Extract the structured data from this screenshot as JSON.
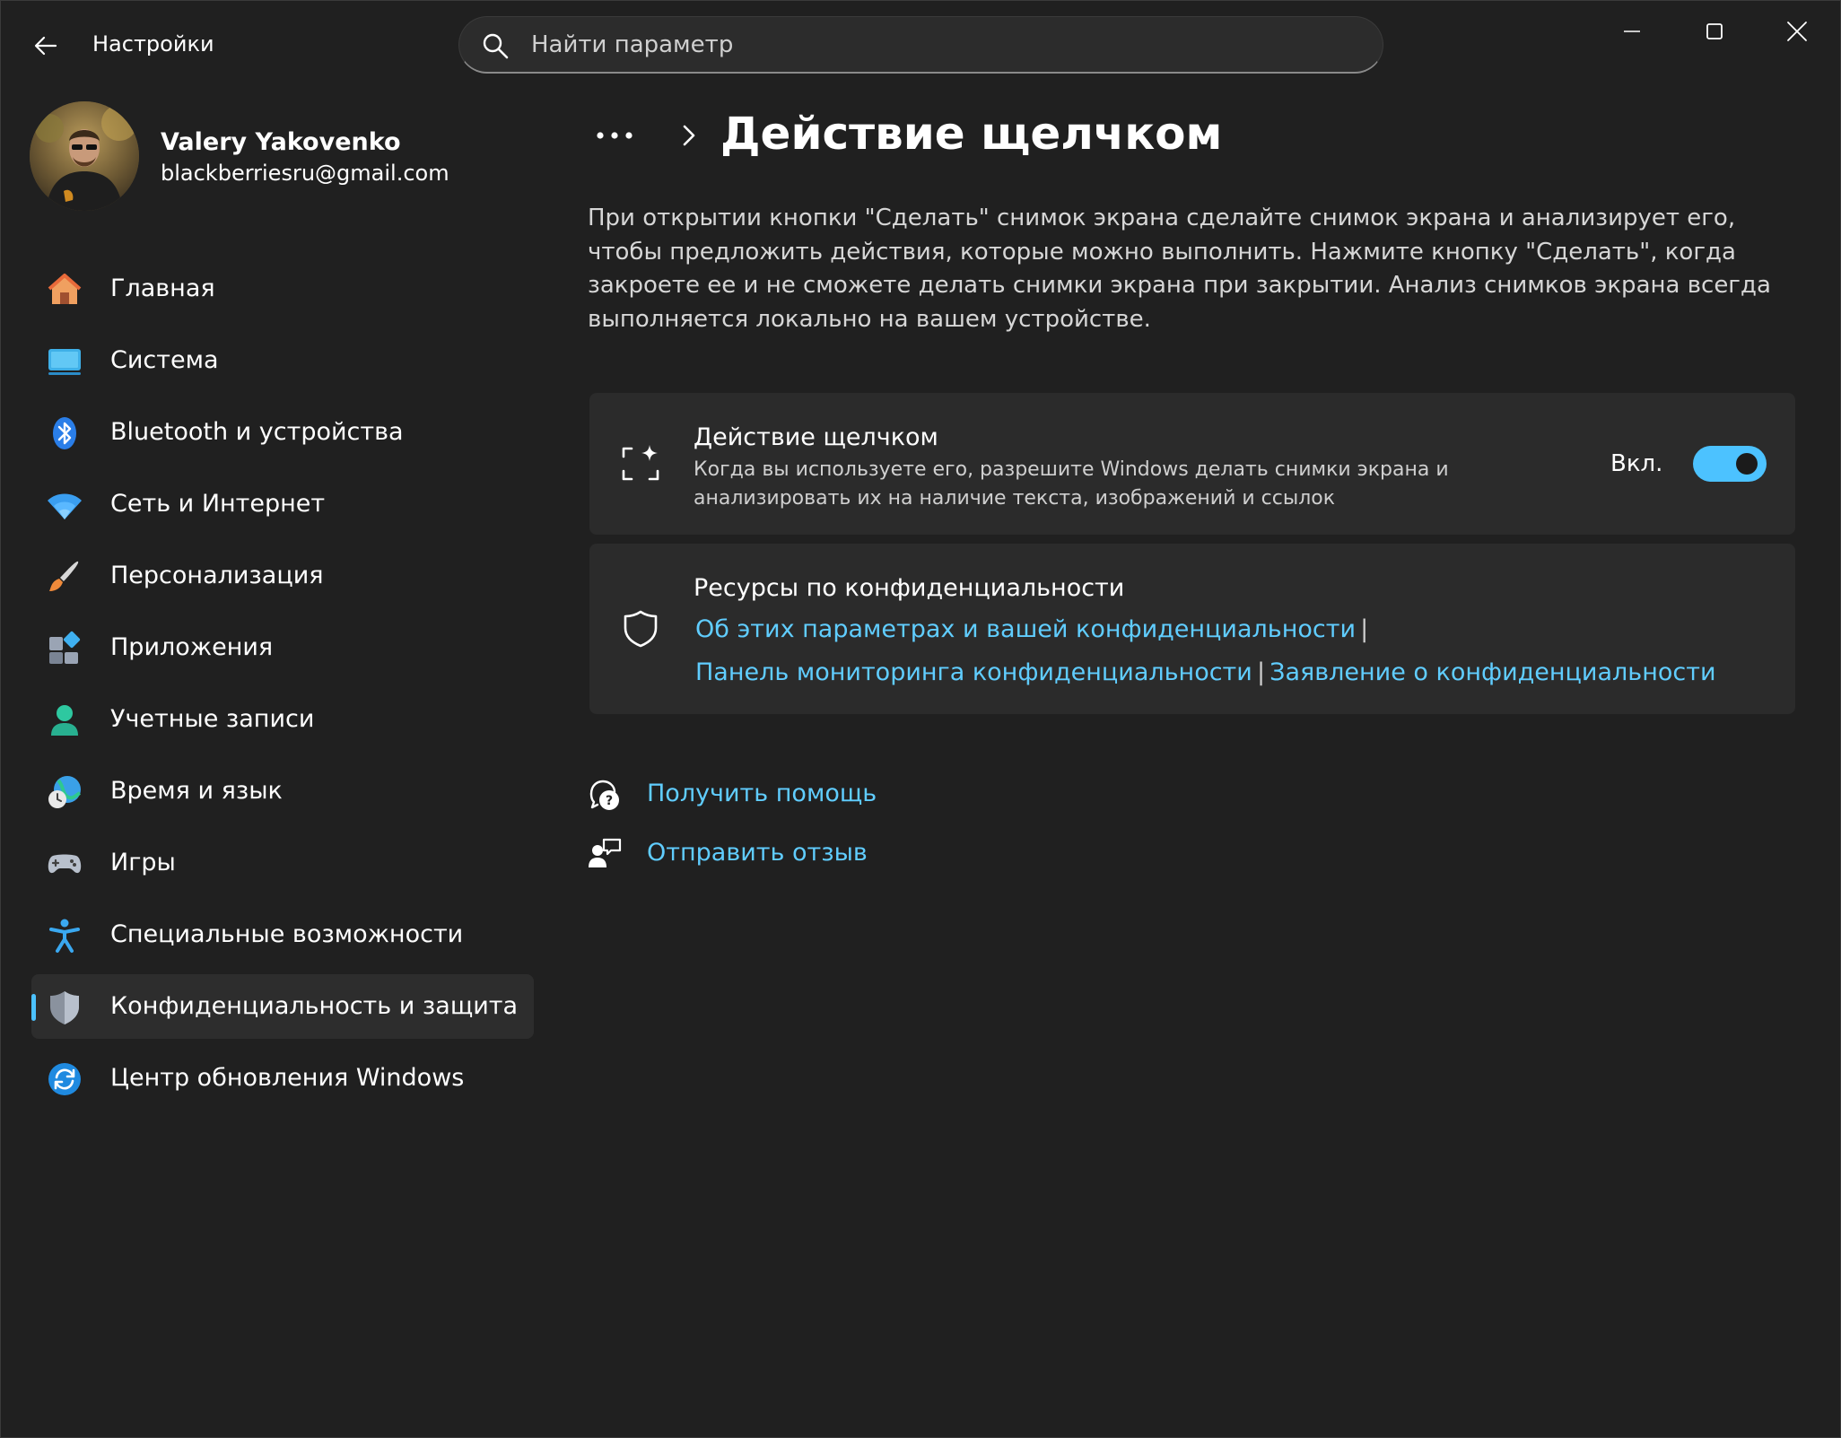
{
  "titlebar": {
    "app_title": "Настройки",
    "search_placeholder": "Найти параметр",
    "icons": [
      "back-arrow-icon",
      "search-icon",
      "minimize-icon",
      "maximize-icon",
      "close-icon"
    ]
  },
  "profile": {
    "name": "Valery Yakovenko",
    "email": "blackberriesru@gmail.com"
  },
  "sidebar": {
    "items": [
      {
        "label": "Главная",
        "icon": "home-icon",
        "active": false
      },
      {
        "label": "Система",
        "icon": "system-monitor-icon",
        "active": false
      },
      {
        "label": "Bluetooth и устройства",
        "icon": "bluetooth-icon",
        "active": false
      },
      {
        "label": "Сеть и Интернет",
        "icon": "wifi-icon",
        "active": false
      },
      {
        "label": "Персонализация",
        "icon": "brush-icon",
        "active": false
      },
      {
        "label": "Приложения",
        "icon": "apps-icon",
        "active": false
      },
      {
        "label": "Учетные записи",
        "icon": "account-icon",
        "active": false
      },
      {
        "label": "Время и язык",
        "icon": "globe-clock-icon",
        "active": false
      },
      {
        "label": "Игры",
        "icon": "gamepad-icon",
        "active": false
      },
      {
        "label": "Специальные возможности",
        "icon": "accessibility-icon",
        "active": false
      },
      {
        "label": "Конфиденциальность и защита",
        "icon": "shield-icon",
        "active": true
      },
      {
        "label": "Центр обновления Windows",
        "icon": "update-icon",
        "active": false
      }
    ]
  },
  "main": {
    "page_title": "Действие щелчком",
    "description": "При открытии кнопки \"Сделать\" снимок экрана сделайте снимок экрана и анализирует его, чтобы предложить действия, которые можно выполнить. Нажмите кнопку \"Сделать\", когда закроете ее и не сможете делать снимки экрана при закрытии. Анализ снимков экрана всегда выполняется локально на вашем устройстве.",
    "click_card": {
      "title": "Действие щелчком",
      "subtitle": "Когда вы используете его, разрешите Windows делать снимки экрана и анализировать их на наличие текста, изображений и ссылок",
      "toggle_state": "Вкл.",
      "toggle_on": true
    },
    "privacy_card": {
      "title": "Ресурсы по конфиденциальности",
      "link1": "Об этих параметрах и вашей конфиденциальности",
      "link2": "Панель мониторинга конфиденциальности",
      "link3": "Заявление о конфиденциальности",
      "separator": "|"
    },
    "help": {
      "get_help": "Получить помощь",
      "feedback": "Отправить отзыв"
    }
  },
  "colors": {
    "background": "#202020",
    "card": "#2b2b2b",
    "accent": "#4cc2ff",
    "link": "#60cdff"
  }
}
